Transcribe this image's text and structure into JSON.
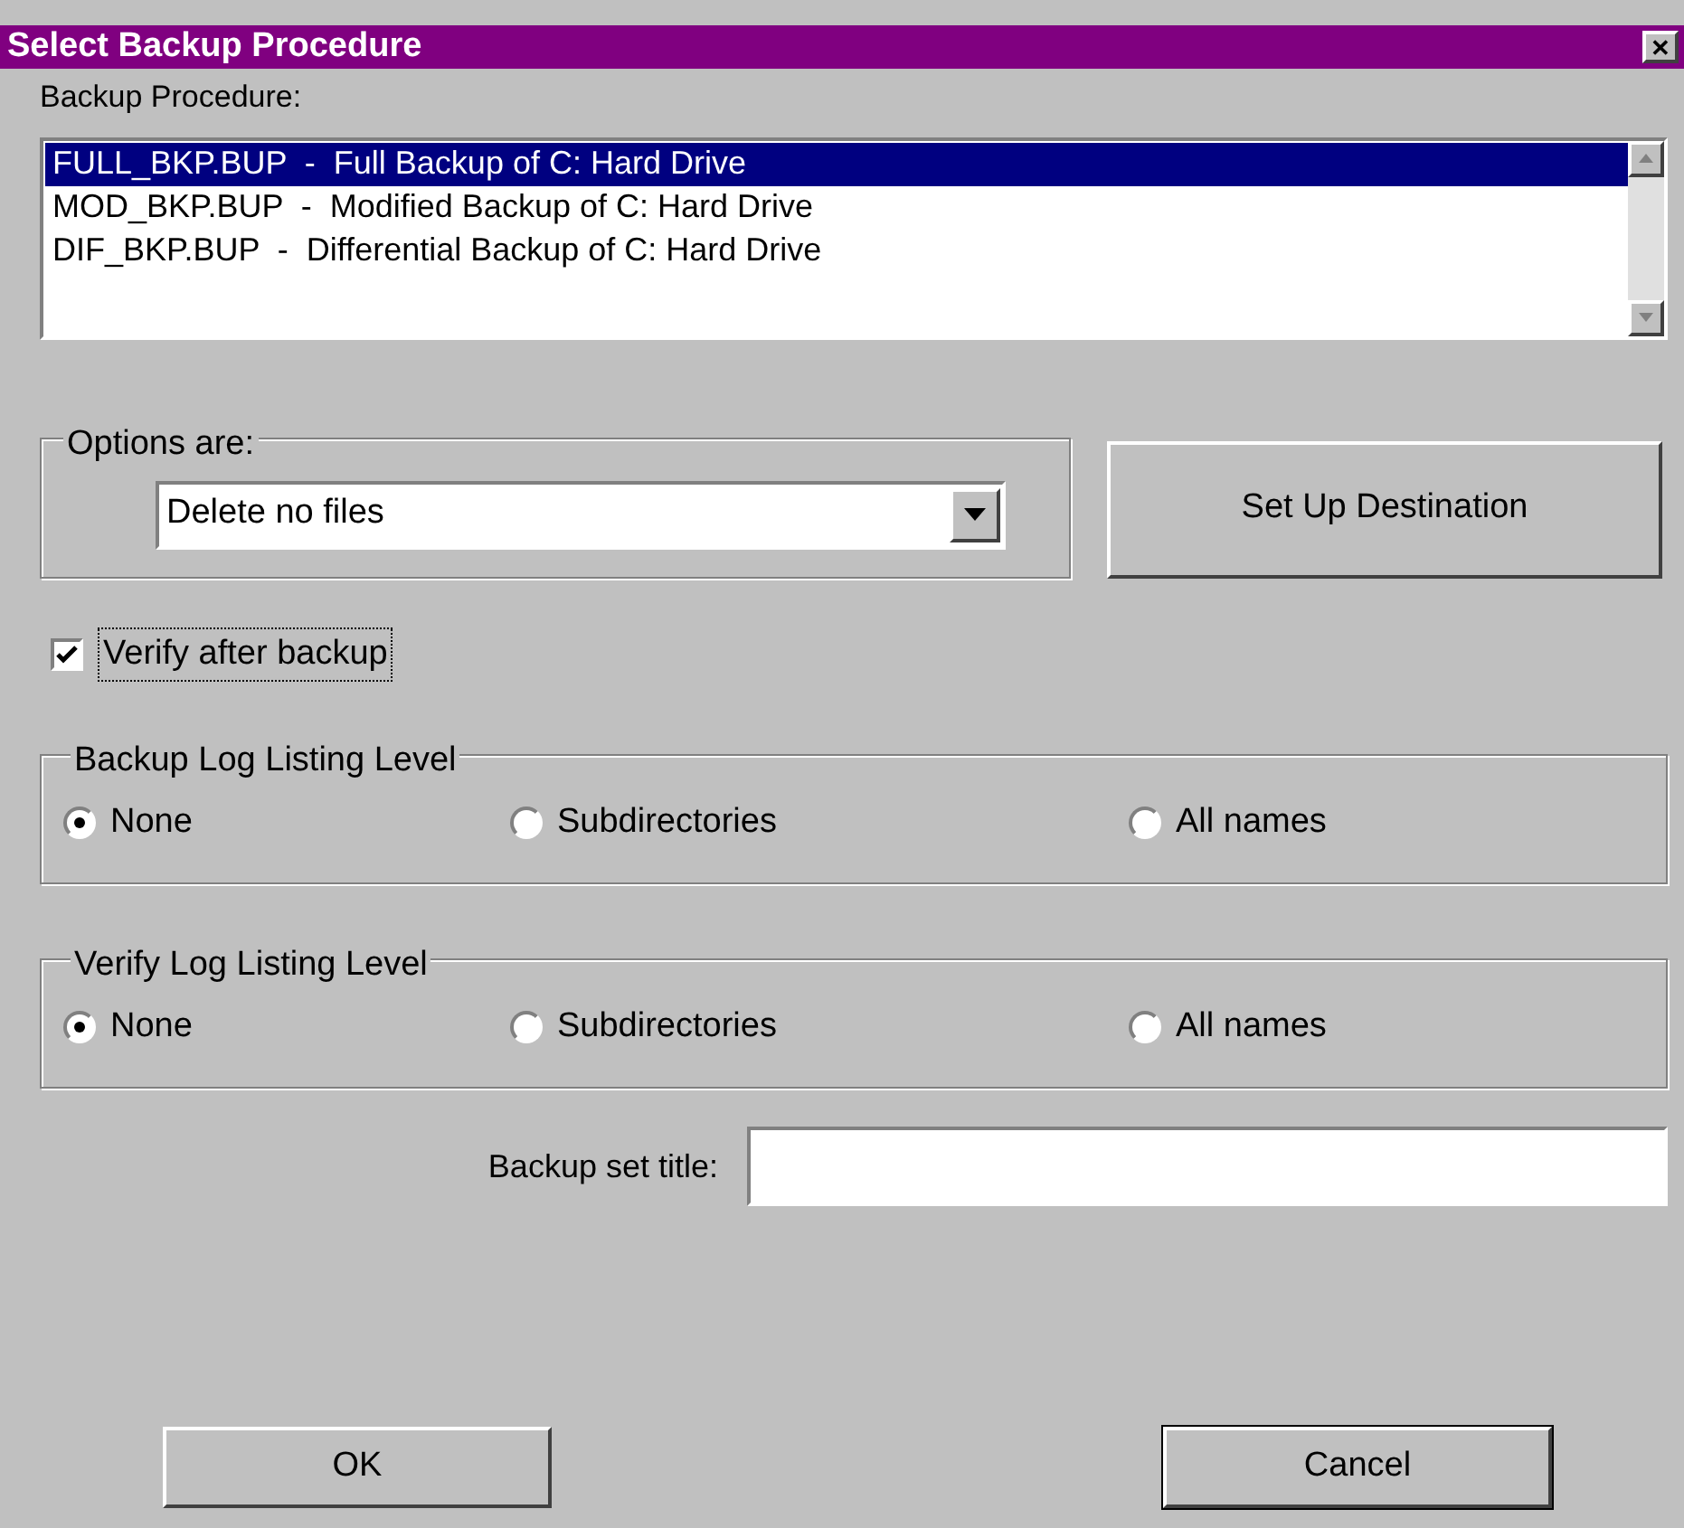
{
  "window": {
    "title": "Select Backup Procedure",
    "close": "✕"
  },
  "procedure": {
    "label": "Backup Procedure:",
    "items": [
      {
        "file": "FULL_BKP.BUP",
        "separator": "-",
        "description": "Full Backup of C: Hard Drive",
        "selected": true
      },
      {
        "file": "MOD_BKP.BUP",
        "separator": "-",
        "description": "Modified Backup of C: Hard Drive",
        "selected": false
      },
      {
        "file": "DIF_BKP.BUP",
        "separator": "-",
        "description": "Differential Backup of C: Hard Drive",
        "selected": false
      }
    ]
  },
  "options": {
    "legend": "Options are:",
    "value": "Delete no files"
  },
  "destination_button": "Set Up Destination",
  "verify": {
    "label": "Verify after backup",
    "checked": true
  },
  "groups": [
    {
      "legend": "Backup Log Listing Level",
      "options": [
        {
          "label": "None",
          "selected": true
        },
        {
          "label": "Subdirectories",
          "selected": false
        },
        {
          "label": "All names",
          "selected": false
        }
      ]
    },
    {
      "legend": "Verify Log Listing Level",
      "options": [
        {
          "label": "None",
          "selected": true
        },
        {
          "label": "Subdirectories",
          "selected": false
        },
        {
          "label": "All names",
          "selected": false
        }
      ]
    }
  ],
  "title_field": {
    "label": "Backup set title:"
  },
  "buttons": [
    {
      "label": "OK",
      "default": false
    },
    {
      "label": "Cancel",
      "default": true
    }
  ]
}
